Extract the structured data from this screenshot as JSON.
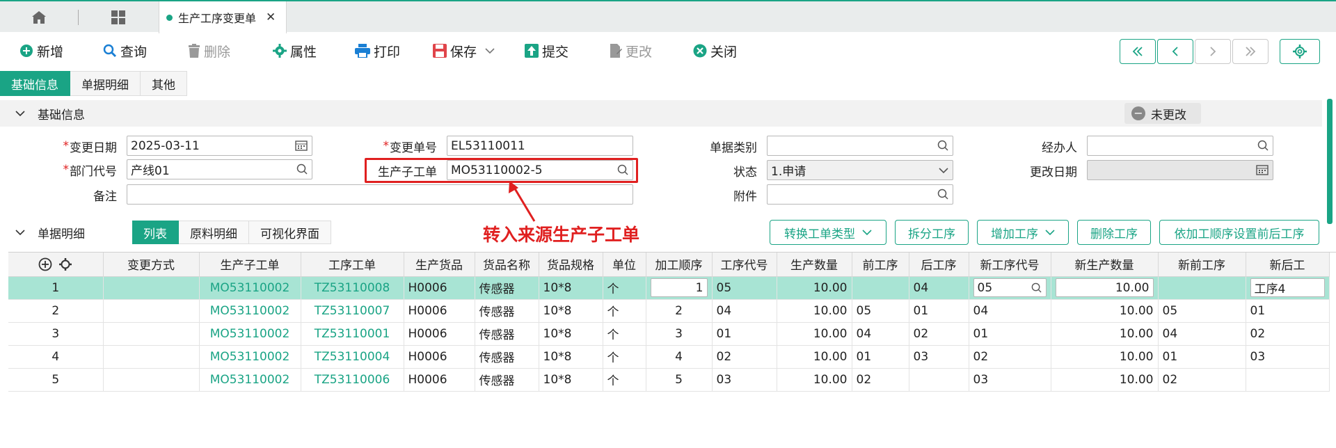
{
  "tabs": {
    "doc_tab": "生产工序变更单"
  },
  "toolbar": {
    "new": "新增",
    "query": "查询",
    "delete": "删除",
    "props": "属性",
    "print": "打印",
    "save": "保存",
    "submit": "提交",
    "modify": "更改",
    "close": "关闭"
  },
  "subtabs": [
    "基础信息",
    "单据明细",
    "其他"
  ],
  "basic": {
    "section_title": "基础信息",
    "unchanged_label": "未更改",
    "labels": {
      "change_date": "变更日期",
      "change_no": "变更单号",
      "doc_type": "单据类别",
      "handler": "经办人",
      "dept_code": "部门代号",
      "sub_order": "生产子工单",
      "status": "状态",
      "modify_date": "更改日期",
      "remark": "备注",
      "attachment": "附件"
    },
    "values": {
      "change_date": "2025-03-11",
      "change_no": "EL53110011",
      "dept_code": "产线01",
      "sub_order": "MO53110002-5",
      "status": "1.申请"
    }
  },
  "annotation": "转入来源生产子工单",
  "detail": {
    "section_title": "单据明细",
    "view_tabs": [
      "列表",
      "原料明细",
      "可视化界面"
    ],
    "actions": [
      "转换工单类型",
      "拆分工序",
      "增加工序",
      "删除工序",
      "依加工顺序设置前后工序"
    ],
    "columns": [
      "变更方式",
      "生产子工单",
      "工序工单",
      "生产货品",
      "货品名称",
      "货品规格",
      "单位",
      "加工顺序",
      "工序代号",
      "生产数量",
      "前工序",
      "后工序",
      "新工序代号",
      "新生产数量",
      "新前工序",
      "新后工"
    ],
    "rows": [
      {
        "idx": "1",
        "mode": "",
        "sub": "MO53110002",
        "proc": "TZ53110008",
        "goods": "H0006",
        "name": "传感器",
        "spec": "10*8",
        "unit": "个",
        "seq": "1",
        "code": "05",
        "qty": "10.00",
        "prev": "",
        "next": "04",
        "new_code": "05",
        "new_qty": "10.00",
        "new_prev": "",
        "new_next": "工序4"
      },
      {
        "idx": "2",
        "mode": "",
        "sub": "MO53110002",
        "proc": "TZ53110007",
        "goods": "H0006",
        "name": "传感器",
        "spec": "10*8",
        "unit": "个",
        "seq": "2",
        "code": "04",
        "qty": "10.00",
        "prev": "05",
        "next": "01",
        "new_code": "04",
        "new_qty": "10.00",
        "new_prev": "05",
        "new_next": "01"
      },
      {
        "idx": "3",
        "mode": "",
        "sub": "MO53110002",
        "proc": "TZ53110001",
        "goods": "H0006",
        "name": "传感器",
        "spec": "10*8",
        "unit": "个",
        "seq": "3",
        "code": "01",
        "qty": "10.00",
        "prev": "04",
        "next": "02",
        "new_code": "01",
        "new_qty": "10.00",
        "new_prev": "04",
        "new_next": "02"
      },
      {
        "idx": "4",
        "mode": "",
        "sub": "MO53110002",
        "proc": "TZ53110004",
        "goods": "H0006",
        "name": "传感器",
        "spec": "10*8",
        "unit": "个",
        "seq": "4",
        "code": "02",
        "qty": "10.00",
        "prev": "01",
        "next": "03",
        "new_code": "02",
        "new_qty": "10.00",
        "new_prev": "01",
        "new_next": "03"
      },
      {
        "idx": "5",
        "mode": "",
        "sub": "MO53110002",
        "proc": "TZ53110006",
        "goods": "H0006",
        "name": "传感器",
        "spec": "10*8",
        "unit": "个",
        "seq": "5",
        "code": "03",
        "qty": "10.00",
        "prev": "02",
        "next": "",
        "new_code": "03",
        "new_qty": "10.00",
        "new_prev": "02",
        "new_next": ""
      }
    ]
  },
  "colors": {
    "accent": "#1aa485",
    "selected_row": "#a8e4d4",
    "annotation": "#e02020"
  }
}
